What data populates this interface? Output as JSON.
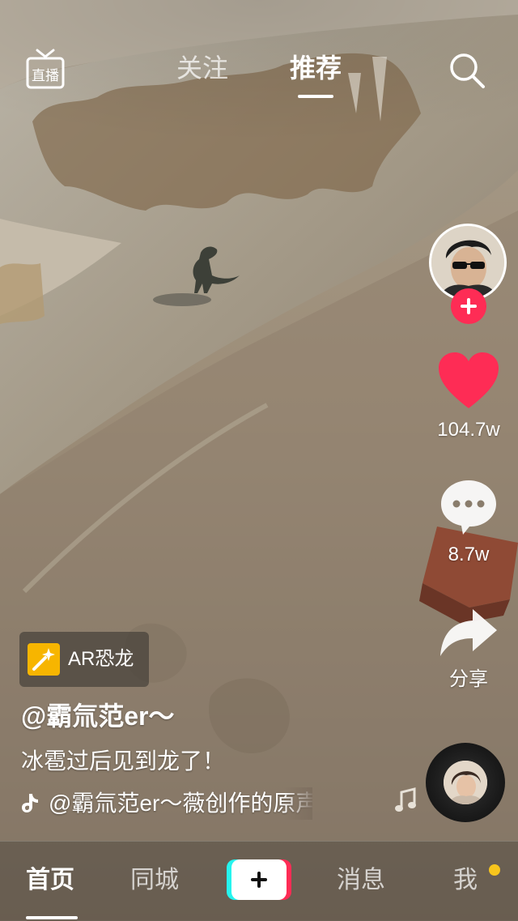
{
  "top_bar": {
    "live_label": "直播",
    "tabs": [
      {
        "label": "关注",
        "active": false
      },
      {
        "label": "推荐",
        "active": true
      }
    ]
  },
  "rail": {
    "like_count": "104.7w",
    "comment_count": "8.7w",
    "share_label": "分享"
  },
  "video_info": {
    "effect_badge": "AR恐龙",
    "username": "@霸氚范er～",
    "caption": "冰雹过后见到龙了！",
    "music": "@霸氚范er～薇创作的原声    @恋高"
  },
  "bottom_nav": {
    "items": [
      {
        "label": "首页",
        "active": true
      },
      {
        "label": "同城",
        "active": false
      },
      {
        "label": "消息",
        "active": false
      },
      {
        "label": "我",
        "active": false
      }
    ]
  },
  "colors": {
    "accent_red": "#fe2c55",
    "accent_cyan": "#25f4ee",
    "badge_yellow": "#f7b500",
    "notify_dot": "#f7c51d"
  },
  "icons": [
    "live-icon",
    "search-icon",
    "heart-icon",
    "comment-icon",
    "share-icon",
    "music-note-icon",
    "plus-icon"
  ]
}
